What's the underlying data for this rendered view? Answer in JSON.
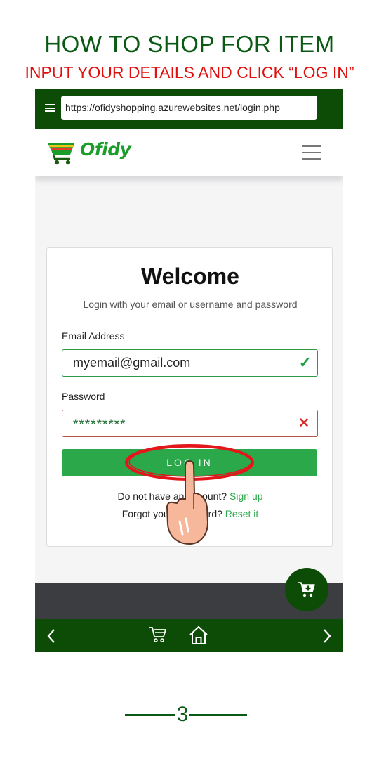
{
  "header": {
    "title": "HOW TO SHOP FOR ITEM",
    "subtitle": "INPUT YOUR DETAILS AND CLICK “LOG IN”"
  },
  "browser": {
    "url": "https://ofidyshopping.azurewebsites.net/login.php"
  },
  "navbar": {
    "logo_text": "Ofidy"
  },
  "login": {
    "welcome": "Welcome",
    "subtitle": "Login with your email or username and password",
    "email_label": "Email Address",
    "email_value": "myemail@gmail.com",
    "password_label": "Password",
    "password_value": "*********",
    "button_label": "LOG IN",
    "signup_prompt": "Do not have an account?",
    "signup_link": "Sign up",
    "forgot_prompt": "Forgot your password?",
    "forgot_link": "Reset it"
  },
  "footer": {
    "page_number": "3"
  },
  "colors": {
    "brand_dark_green": "#0d4c06",
    "button_green": "#2aa84a",
    "heading_green": "#0b5a14",
    "subtitle_red": "#e10e0e",
    "highlight_red": "#e3161b"
  },
  "icons": {
    "menu": "menu-icon",
    "hamburger": "hamburger-icon",
    "valid": "check-icon",
    "invalid": "x-icon",
    "cart_add": "cart-plus-icon",
    "back": "chevron-left-icon",
    "forward": "chevron-right-icon",
    "cart": "cart-icon",
    "home": "home-icon",
    "pointer": "pointing-hand-icon"
  }
}
